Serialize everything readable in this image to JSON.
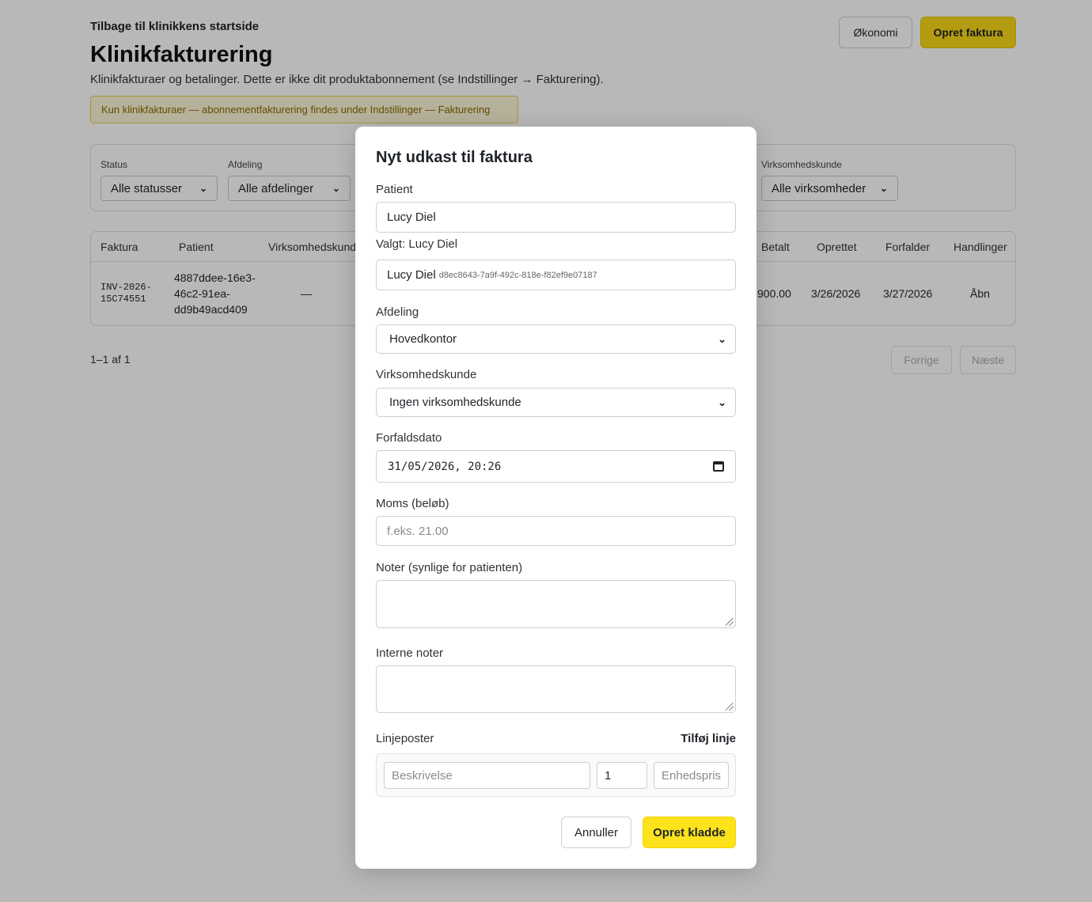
{
  "header": {
    "back_link": "Tilbage til klinikkens startside",
    "title": "Klinikfakturering",
    "subtitle": "Klinikfakturaer og betalinger. Dette er ikke dit produktabonnement (se Indstillinger → Fakturering).",
    "notice": "Kun klinikfakturaer — abonnementfakturering findes under Indstillinger — Fakturering",
    "okonomi_label": "Økonomi",
    "opret_faktura_label": "Opret faktura"
  },
  "filters": {
    "status": {
      "label": "Status",
      "value": "Alle statusser"
    },
    "afdeling": {
      "label": "Afdeling",
      "value": "Alle afdelinger"
    },
    "virksomhedskunde": {
      "label": "Virksomhedskunde",
      "value": "Alle virksomheder"
    }
  },
  "table": {
    "columns": [
      "Faktura",
      "Patient",
      "Virksomhedskunde",
      "Betalt",
      "Oprettet",
      "Forfalder",
      "Handlinger"
    ],
    "rows": [
      {
        "faktura_line1": "INV-2026-",
        "faktura_line2": "15C74551",
        "patient_line1": "4887ddee-16e3-",
        "patient_line2": "46c2-91ea-",
        "patient_line3": "dd9b49acd409",
        "virksomhedskunde": "—",
        "betalt": "900.00",
        "oprettet": "3/26/2026",
        "forfalder": "3/27/2026",
        "handling": "Åbn"
      }
    ]
  },
  "pagination": {
    "info": "1–1 af 1",
    "prev": "Forrige",
    "next": "Næste"
  },
  "modal": {
    "title": "Nyt udkast til faktura",
    "patient_label": "Patient",
    "patient_value": "Lucy Diel",
    "selected_text": "Valgt: Lucy Diel",
    "selected_name": "Lucy Diel",
    "selected_id": "d8ec8643-7a9f-492c-818e-f82ef9e07187",
    "afdeling_label": "Afdeling",
    "afdeling_value": "Hovedkontor",
    "virksomhedskunde_label": "Virksomhedskunde",
    "virksomhedskunde_value": "Ingen virksomhedskunde",
    "forfaldsdato_label": "Forfaldsdato",
    "forfaldsdato_value": "31/05/2026, 20:26",
    "moms_label": "Moms (beløb)",
    "moms_placeholder": "f.eks. 21.00",
    "noter_label": "Noter (synlige for patienten)",
    "interne_noter_label": "Interne noter",
    "linjeposter_label": "Linjeposter",
    "tilfoj_linje": "Tilføj linje",
    "line_item": {
      "beskrivelse_placeholder": "Beskrivelse",
      "quantity": "1",
      "enhedspris_placeholder": "Enhedspris"
    },
    "cancel_label": "Annuller",
    "submit_label": "Opret kladde"
  }
}
